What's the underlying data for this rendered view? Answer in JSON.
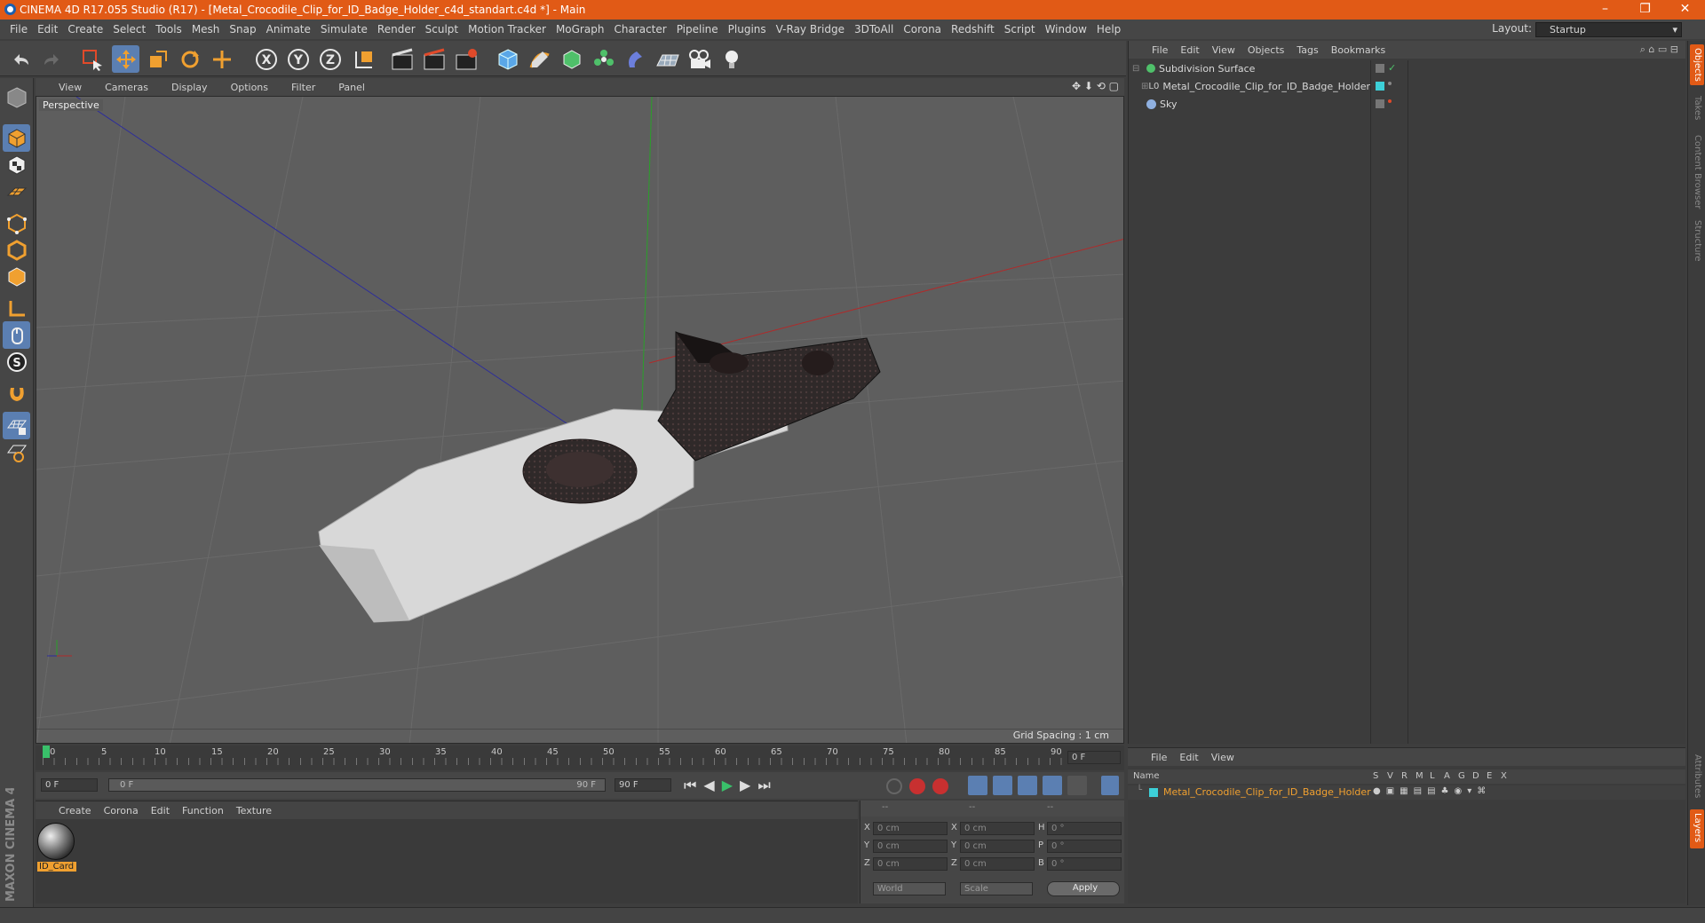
{
  "window": {
    "title": "CINEMA 4D R17.055 Studio (R17) - [Metal_Crocodile_Clip_for_ID_Badge_Holder_c4d_standart.c4d *] - Main",
    "minimize": "–",
    "restore": "❐",
    "close": "✕"
  },
  "menu": {
    "items": [
      "File",
      "Edit",
      "Create",
      "Select",
      "Tools",
      "Mesh",
      "Snap",
      "Animate",
      "Simulate",
      "Render",
      "Sculpt",
      "Motion Tracker",
      "MoGraph",
      "Character",
      "Pipeline",
      "Plugins",
      "V-Ray Bridge",
      "3DToAll",
      "Corona",
      "Redshift",
      "Script",
      "Window",
      "Help"
    ],
    "layout_label": "Layout:",
    "layout_value": "Startup"
  },
  "toolbar": {
    "axis_x": "X",
    "axis_y": "Y",
    "axis_z": "Z"
  },
  "viewport": {
    "menu": [
      "View",
      "Cameras",
      "Display",
      "Options",
      "Filter",
      "Panel"
    ],
    "label": "Perspective",
    "grid_spacing": "Grid Spacing : 1 cm"
  },
  "timeline": {
    "ticks": [
      "0",
      "5",
      "10",
      "15",
      "20",
      "25",
      "30",
      "35",
      "40",
      "45",
      "50",
      "55",
      "60",
      "65",
      "70",
      "75",
      "80",
      "85",
      "90"
    ],
    "current_frame": "0 F",
    "start_field": "0 F",
    "range_start": "0 F",
    "range_end": "90 F",
    "end_field": "90 F"
  },
  "material_panel": {
    "menu": [
      "Create",
      "Corona",
      "Edit",
      "Function",
      "Texture"
    ],
    "material_name": "ID_Card"
  },
  "coord_panel": {
    "header": [
      "--",
      "--",
      "--"
    ],
    "rows": [
      {
        "a": "X",
        "av": "0 cm",
        "b": "X",
        "bv": "0 cm",
        "c": "H",
        "cv": "0 °"
      },
      {
        "a": "Y",
        "av": "0 cm",
        "b": "Y",
        "bv": "0 cm",
        "c": "P",
        "cv": "0 °"
      },
      {
        "a": "Z",
        "av": "0 cm",
        "b": "Z",
        "bv": "0 cm",
        "c": "B",
        "cv": "0 °"
      }
    ],
    "world": "World",
    "scale": "Scale",
    "apply": "Apply"
  },
  "object_panel": {
    "menu": [
      "File",
      "Edit",
      "View",
      "Objects",
      "Tags",
      "Bookmarks"
    ],
    "objects": [
      {
        "name": "Subdivision Surface",
        "indent": 0
      },
      {
        "name": "Metal_Crocodile_Clip_for_ID_Badge_Holder",
        "indent": 1
      },
      {
        "name": "Sky",
        "indent": 0
      }
    ]
  },
  "layer_panel": {
    "menu": [
      "File",
      "Edit",
      "View"
    ],
    "name_header": "Name",
    "flags": [
      "S",
      "V",
      "R",
      "M",
      "L",
      "A",
      "G",
      "D",
      "E",
      "X"
    ],
    "row_name": "Metal_Crocodile_Clip_for_ID_Badge_Holder"
  },
  "right_tabs": [
    "Objects",
    "Takes",
    "Content Browser",
    "Structure"
  ],
  "right_tabs_lower": [
    "Attributes",
    "Layers"
  ],
  "brand": "MAXON CINEMA 4D",
  "colors": {
    "title_bar": "#e15a16",
    "highlight": "#5b7fb2",
    "accent_orange": "#f0a030"
  }
}
